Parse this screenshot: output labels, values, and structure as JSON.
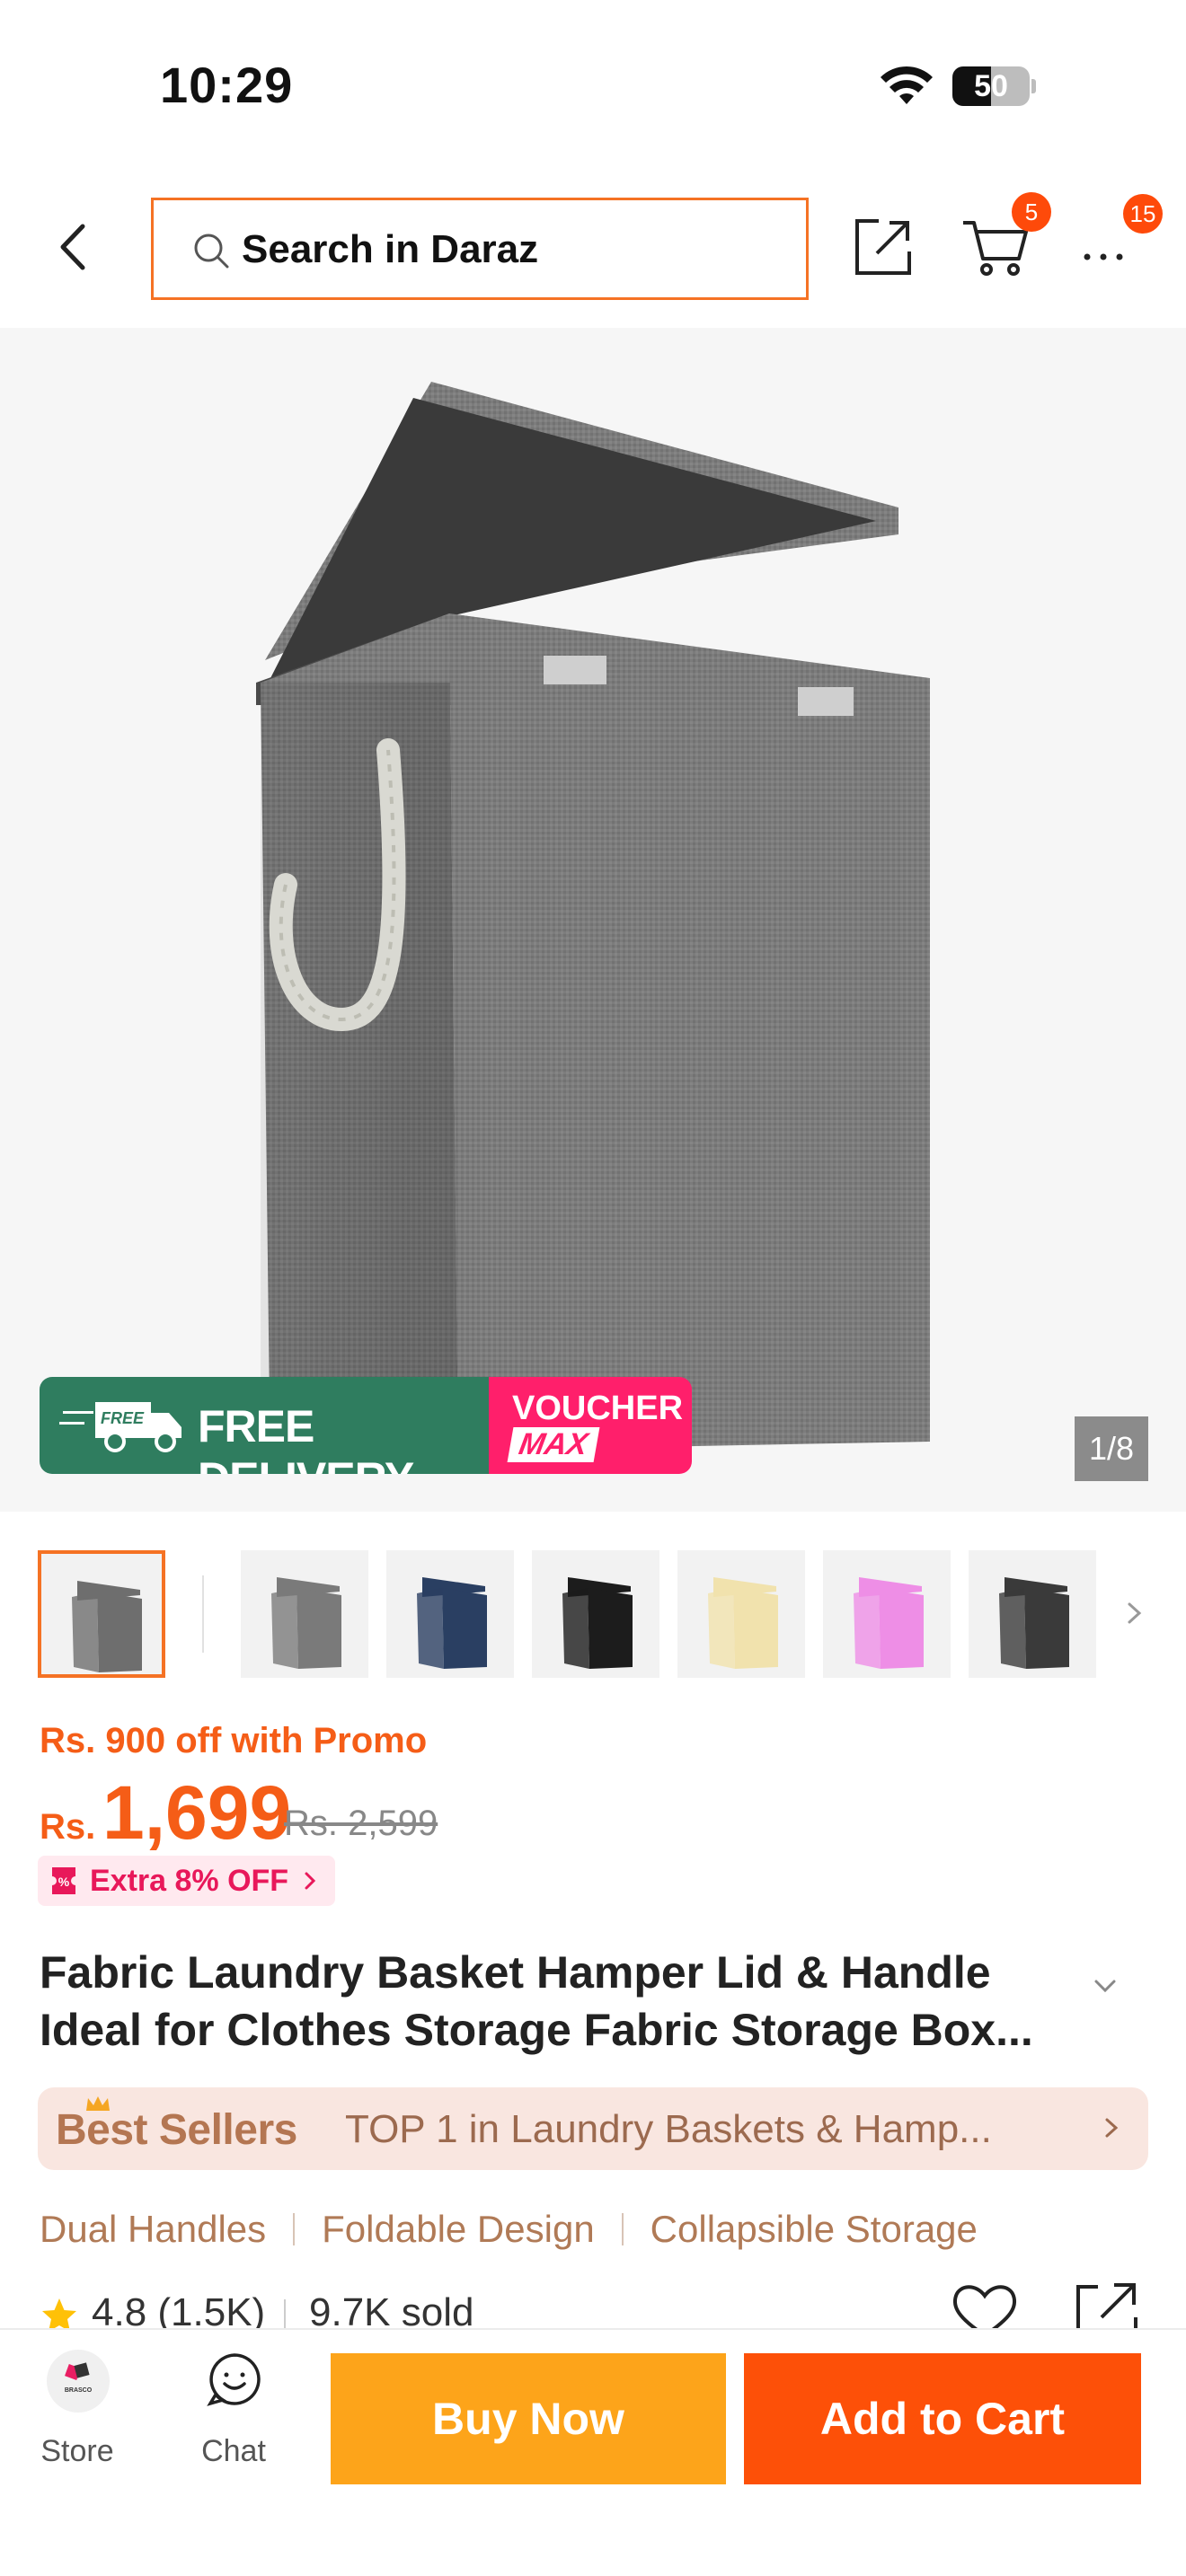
{
  "status_bar": {
    "time": "10:29",
    "battery": "50",
    "battery_level": 0.5
  },
  "header": {
    "search_placeholder": "Search in Daraz",
    "cart_badge": "5",
    "more_badge": "15"
  },
  "gallery": {
    "promo_free_delivery": "FREE DELIVERY",
    "promo_free_tag": "FREE",
    "promo_voucher": "VOUCHER",
    "promo_max": "MAX",
    "counter": "1/8",
    "thumbnails": [
      {
        "color": "#6e6e6e"
      },
      {
        "color": "#7a7a7a"
      },
      {
        "color": "#2a3f62"
      },
      {
        "color": "#1c1c1c"
      },
      {
        "color": "#f1e2ad"
      },
      {
        "color": "#ee8ee6"
      },
      {
        "color": "#3a3a3a"
      }
    ]
  },
  "price": {
    "promo_text": "Rs. 900 off with Promo",
    "currency": "Rs.",
    "current": "1,699",
    "original": "Rs. 2,599",
    "extra_off": "Extra 8% OFF"
  },
  "product": {
    "title": "Fabric Laundry Basket Hamper Lid & Handle Ideal for Clothes Storage Fabric Storage Box...",
    "best_sellers_label": "Best Sellers",
    "best_sellers_rank": "TOP 1 in Laundry Baskets & Hamp...",
    "features": [
      "Dual Handles",
      "Foldable Design",
      "Collapsible Storage"
    ],
    "rating": "4.8 (1.5K)",
    "sold": "9.7K sold"
  },
  "bottom_bar": {
    "store_label": "Store",
    "store_logo_text": "BRASCO",
    "chat_label": "Chat",
    "buy_now": "Buy Now",
    "add_to_cart": "Add to Cart"
  },
  "colors": {
    "accent": "#f57224",
    "buy_now": "#fda41a",
    "add_to_cart": "#fd5008",
    "price": "#f55d17",
    "free_delivery": "#2f7d5f",
    "voucher": "#ff1f6b"
  }
}
